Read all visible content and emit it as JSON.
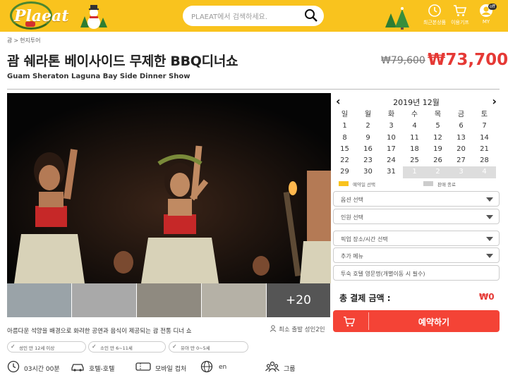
{
  "header": {
    "logo": "Plaeat",
    "search_placeholder": "PLAEAT에서 검색하세요.",
    "recent_label": "최근본상품",
    "cart_label": "이용기프",
    "my_label": "MY",
    "off_badge": "off",
    "bg_color": "#f9c31e"
  },
  "breadcrumb": {
    "home": "괌",
    "current": "현지투어"
  },
  "product": {
    "title": "괌 쉐라톤 베이사이드 무제한 BBQ디너쇼",
    "subtitle": "Guam Sheraton Laguna Bay Side Dinner Show",
    "price_original": "₩79,600",
    "price_sale": "₩73,700"
  },
  "gallery": {
    "more_count": "+20"
  },
  "calendar": {
    "month": "2019년 12월",
    "weekdays": [
      "일",
      "월",
      "화",
      "수",
      "목",
      "금",
      "토"
    ],
    "days": [
      "1",
      "2",
      "3",
      "4",
      "5",
      "6",
      "7",
      "8",
      "9",
      "10",
      "11",
      "12",
      "13",
      "14",
      "15",
      "16",
      "17",
      "18",
      "19",
      "20",
      "21",
      "22",
      "23",
      "24",
      "25",
      "26",
      "27",
      "28",
      "29",
      "30",
      "31",
      "1",
      "2",
      "3",
      "4"
    ],
    "next_month_days_count": 4
  },
  "legend": {
    "available": "예약일 선택",
    "soldout": "판매 종료",
    "available_color": "#f9c31e",
    "soldout_color": "#cccccc"
  },
  "options": {
    "option_select": "옵션 선택",
    "people_select": "인원 선택",
    "pickup_select": "픽업 장소/시간 선택",
    "extra_menu": "추가 메뉴",
    "hotel_name": "투숙 호텔 영문명(개별이동 시 필수)"
  },
  "payment": {
    "total_label": "총 결제 금액 :",
    "total_value": "₩0",
    "book_label": "예약하기",
    "button_color": "#f44336"
  },
  "description": {
    "summary": "아름다운 석양을 배경으로 화려한 공연과 음식이 제공되는 괌 전통 디너 쇼",
    "min_people": "최소 출발 성인2인",
    "chips": [
      "성인 만 12세 이상",
      "소인 만 6~11세",
      "유아 만 0~5세"
    ]
  },
  "info": {
    "duration": "03시간 00분",
    "transfer": "호텔-호텔",
    "voucher": "모바일 컵처",
    "language": "en",
    "group": "그룹"
  }
}
